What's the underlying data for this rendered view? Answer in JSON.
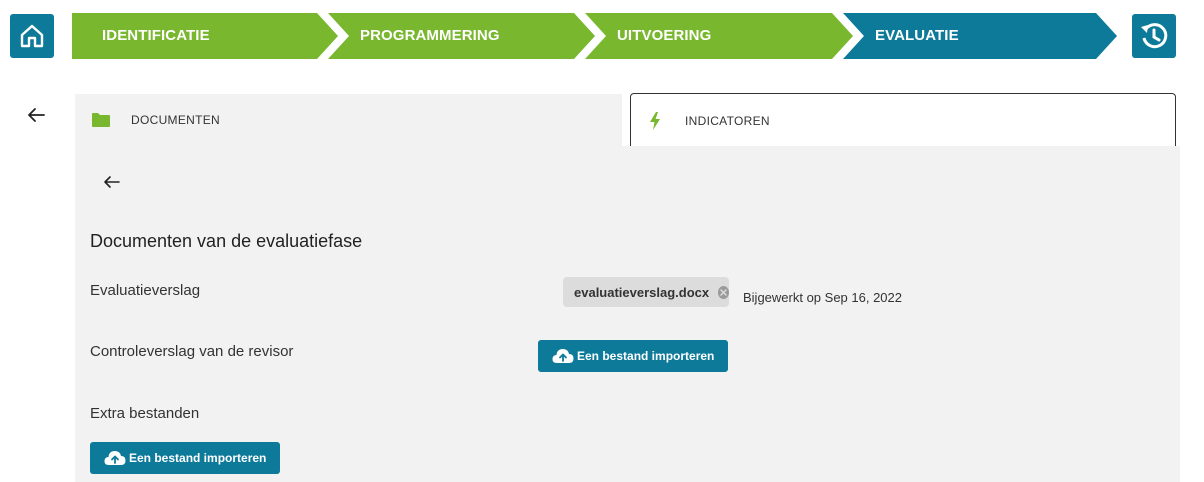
{
  "header": {
    "steps": [
      {
        "label": "IDENTIFICATIE"
      },
      {
        "label": "PROGRAMMERING"
      },
      {
        "label": "UITVOERING"
      },
      {
        "label": "EVALUATIE"
      }
    ],
    "home_icon": "home-icon",
    "history_icon": "history-icon"
  },
  "colors": {
    "step_done": "#78b72e",
    "step_active": "#0e7a9a",
    "accent": "#0e7a9a",
    "panel_bg": "#f2f2f2"
  },
  "tabs": [
    {
      "label": "DOCUMENTEN",
      "icon": "folder-icon",
      "active": false
    },
    {
      "label": "INDICATOREN",
      "icon": "bolt-icon",
      "active": true
    }
  ],
  "main": {
    "title": "Documenten van de evaluatiefase",
    "rows": {
      "evaluation_report": {
        "label": "Evaluatieverslag",
        "file": "evaluatieverslag.docx",
        "updated": "Bijgewerkt op Sep 16, 2022"
      },
      "auditor_report": {
        "label": "Controleverslag van de revisor",
        "button": "Een bestand importeren"
      },
      "extra_files": {
        "label": "Extra bestanden",
        "button": "Een bestand importeren"
      }
    }
  }
}
